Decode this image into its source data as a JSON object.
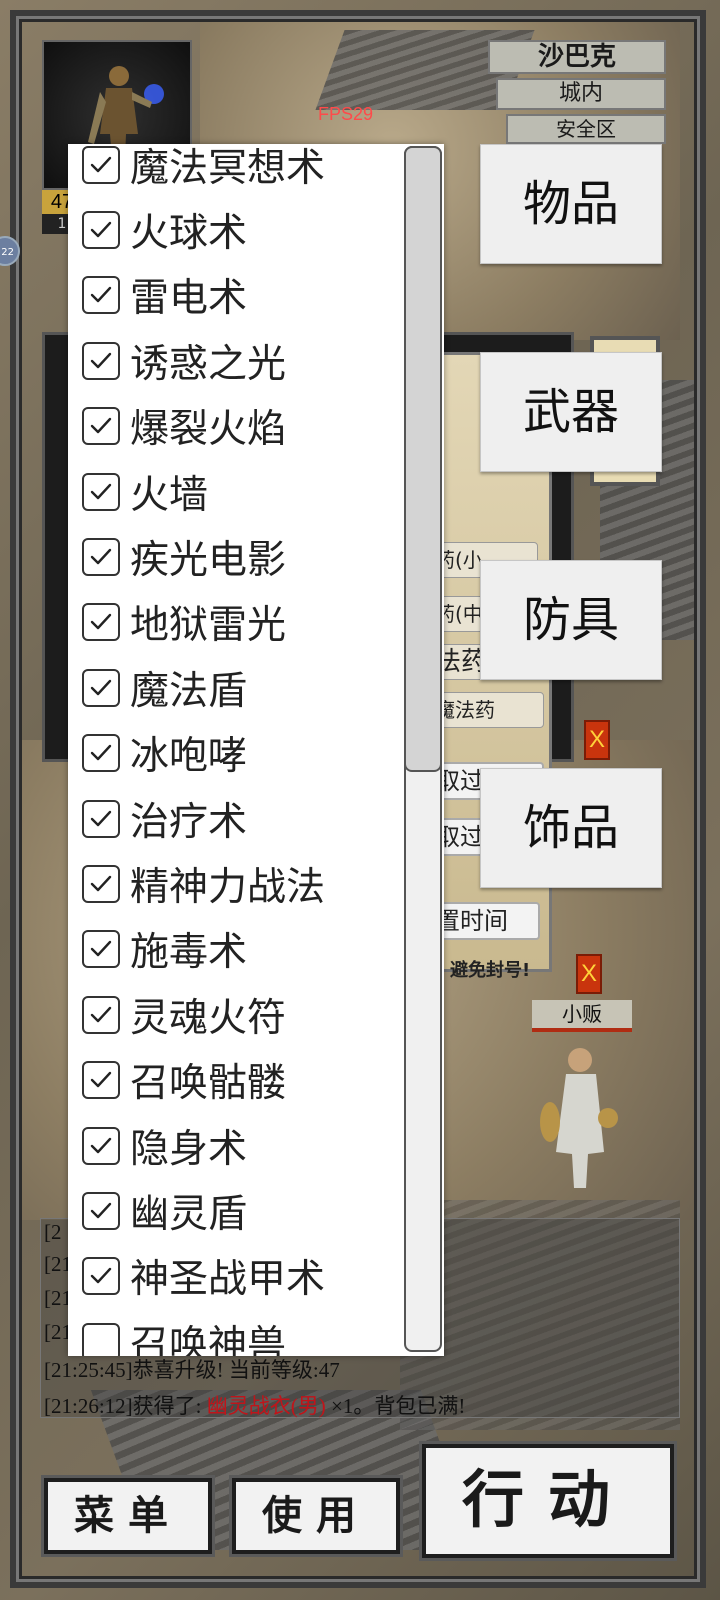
{
  "hud": {
    "fps": "FPS29",
    "level_box": "47",
    "level_sub": "1",
    "side_badge": "22",
    "location": {
      "city": "沙巴克",
      "area": "城内",
      "zone": "安全区"
    }
  },
  "background_panel": {
    "pills": [
      "药(小",
      "药(中",
      "法药",
      "魔法药",
      "取过滤",
      "取过滤",
      "置时间"
    ],
    "warning": "，避免封号!",
    "npc_label": "小贩",
    "close_mark": "X"
  },
  "skill_list": {
    "items": [
      {
        "label": "魔法冥想术",
        "checked": true
      },
      {
        "label": "火球术",
        "checked": true
      },
      {
        "label": "雷电术",
        "checked": true
      },
      {
        "label": "诱惑之光",
        "checked": true
      },
      {
        "label": "爆裂火焰",
        "checked": true
      },
      {
        "label": "火墙",
        "checked": true
      },
      {
        "label": "疾光电影",
        "checked": true
      },
      {
        "label": "地狱雷光",
        "checked": true
      },
      {
        "label": "魔法盾",
        "checked": true
      },
      {
        "label": "冰咆哮",
        "checked": true
      },
      {
        "label": "治疗术",
        "checked": true
      },
      {
        "label": "精神力战法",
        "checked": true
      },
      {
        "label": "施毒术",
        "checked": true
      },
      {
        "label": "灵魂火符",
        "checked": true
      },
      {
        "label": "召唤骷髅",
        "checked": true
      },
      {
        "label": "隐身术",
        "checked": true
      },
      {
        "label": "幽灵盾",
        "checked": true
      },
      {
        "label": "神圣战甲术",
        "checked": true
      },
      {
        "label": "召唤神兽",
        "checked": false
      }
    ]
  },
  "categories": {
    "items": "物品",
    "weapons": "武器",
    "armor": "防具",
    "accessories": "饰品"
  },
  "log": {
    "clipped": [
      "[2",
      "[21",
      "[21",
      "[21"
    ],
    "line1": "[21:25:45]恭喜升级! 当前等级:47",
    "line2_prefix": "[21:26:12]获得了: ",
    "line2_item": "幽灵战衣(男)",
    "line2_suffix": " ×1。背包已满!"
  },
  "buttons": {
    "menu": "菜单",
    "use": "使用",
    "action": "行动"
  },
  "colors": {
    "fps": "#ff4a4a",
    "item_highlight": "#c0141a",
    "close_button": "#c9340d"
  }
}
